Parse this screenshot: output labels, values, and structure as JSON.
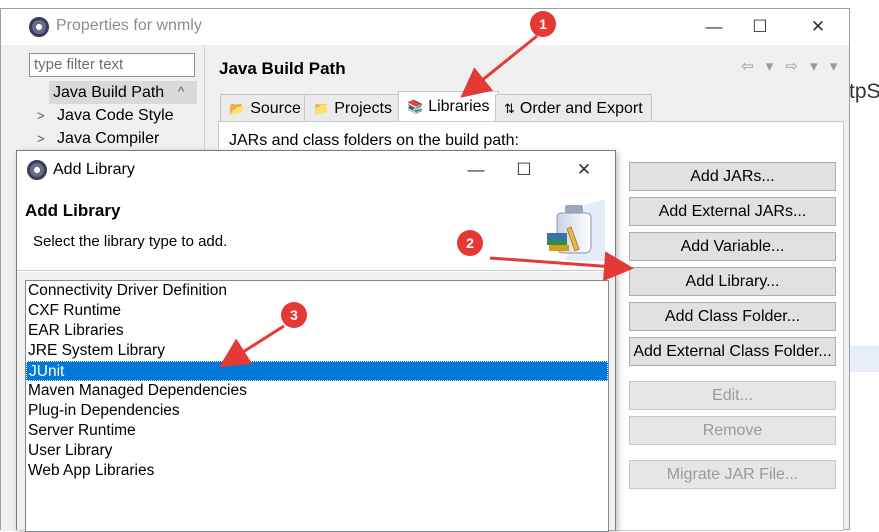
{
  "background": {
    "text": "tpS"
  },
  "properties": {
    "title": "Properties for wnmly",
    "filter_placeholder": "type filter text",
    "tree": [
      {
        "label": "Java Build Path",
        "arrow": ""
      },
      {
        "label": "Java Code Style",
        "arrow": ">"
      },
      {
        "label": "Java Compiler",
        "arrow": ">"
      }
    ],
    "tree_scroll_up": "^",
    "page_title": "Java Build Path",
    "nav": "⇦ ▾ ⇨ ▾ ▾",
    "tabs": [
      {
        "label": "Source",
        "icon": "source-icon"
      },
      {
        "label": "Projects",
        "icon": "projects-icon"
      },
      {
        "label": "Libraries",
        "icon": "libraries-icon"
      },
      {
        "label": "Order and Export",
        "icon": "order-icon"
      }
    ],
    "build_path_label": "JARs and class folders on the build path:",
    "buttons": {
      "add_jars": "Add JARs...",
      "add_external_jars": "Add External JARs...",
      "add_variable": "Add Variable...",
      "add_library": "Add Library...",
      "add_class_folder": "Add Class Folder...",
      "add_external_class_folder": "Add External Class Folder...",
      "edit": "Edit...",
      "remove": "Remove",
      "migrate": "Migrate JAR File..."
    },
    "window_controls": {
      "minimize": "—",
      "maximize": "☐",
      "close": "✕"
    }
  },
  "add_library": {
    "title": "Add Library",
    "header_title": "Add Library",
    "description": "Select the library type to add.",
    "window_controls": {
      "minimize": "—",
      "maximize": "☐",
      "close": "✕"
    },
    "items": [
      "Connectivity Driver Definition",
      "CXF Runtime",
      "EAR Libraries",
      "JRE System Library",
      "JUnit",
      "Maven Managed Dependencies",
      "Plug-in Dependencies",
      "Server Runtime",
      "User Library",
      "Web App Libraries"
    ],
    "selected": "JUnit"
  },
  "annotations": [
    {
      "label": "1"
    },
    {
      "label": "2"
    },
    {
      "label": "3"
    }
  ],
  "colors": {
    "selection": "#0078d7",
    "annotation": "#e53935"
  }
}
